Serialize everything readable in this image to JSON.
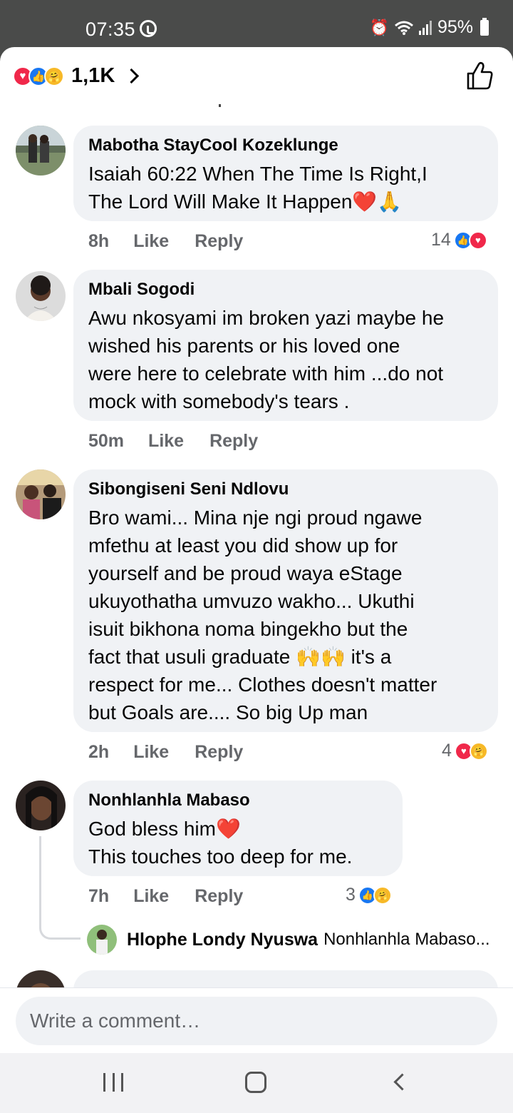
{
  "status_bar": {
    "time": "07:35",
    "battery": "95%",
    "icons": [
      "whatsapp-icon",
      "alarm-icon",
      "wifi-icon",
      "signal-icon",
      "battery-icon"
    ]
  },
  "header": {
    "reaction_count": "1,1K",
    "reaction_icons": [
      "love-reaction-icon",
      "like-reaction-icon",
      "care-reaction-icon"
    ]
  },
  "comments": [
    {
      "author": "Mabotha StayCool Kozeklunge",
      "text": "Isaiah 60:22 When The Time Is Right,I\nThe Lord Will Make It Happen❤️🙏",
      "time": "8h",
      "like_label": "Like",
      "reply_label": "Reply",
      "reaction_count": "14",
      "reactions": [
        "like-reaction-icon",
        "love-reaction-icon"
      ]
    },
    {
      "author": "Mbali Sogodi",
      "text": "Awu nkosyami im broken yazi maybe he\nwished his parents or his loved one\nwere here to celebrate with him ...do not\nmock with somebody's tears .",
      "time": "50m",
      "like_label": "Like",
      "reply_label": "Reply"
    },
    {
      "author": "Sibongiseni Seni Ndlovu",
      "text": "Bro wami... Mina nje ngi proud ngawe\nmfethu at least you did show up for\nyourself and be proud waya eStage\nukuyothatha umvuzo wakho... Ukuthi\nisuit bikhona noma bingekho but the\nfact that usuli graduate 🙌🙌 it's a\nrespect for me... Clothes doesn't matter\nbut Goals are.... So big Up man",
      "time": "2h",
      "like_label": "Like",
      "reply_label": "Reply",
      "reaction_count": "4",
      "reactions": [
        "love-reaction-icon",
        "care-reaction-icon"
      ]
    },
    {
      "author": "Nonhlanhla Mabaso",
      "text": "God bless him❤️\nThis touches too deep for me.",
      "time": "7h",
      "like_label": "Like",
      "reply_label": "Reply",
      "reaction_count": "3",
      "reactions": [
        "like-reaction-icon",
        "care-reaction-icon"
      ],
      "reply_preview": {
        "author": "Hlophe Londy Nyuswa",
        "snippet": "Nonhlanhla Mabaso..."
      }
    }
  ],
  "composer": {
    "placeholder": "Write a comment…"
  }
}
